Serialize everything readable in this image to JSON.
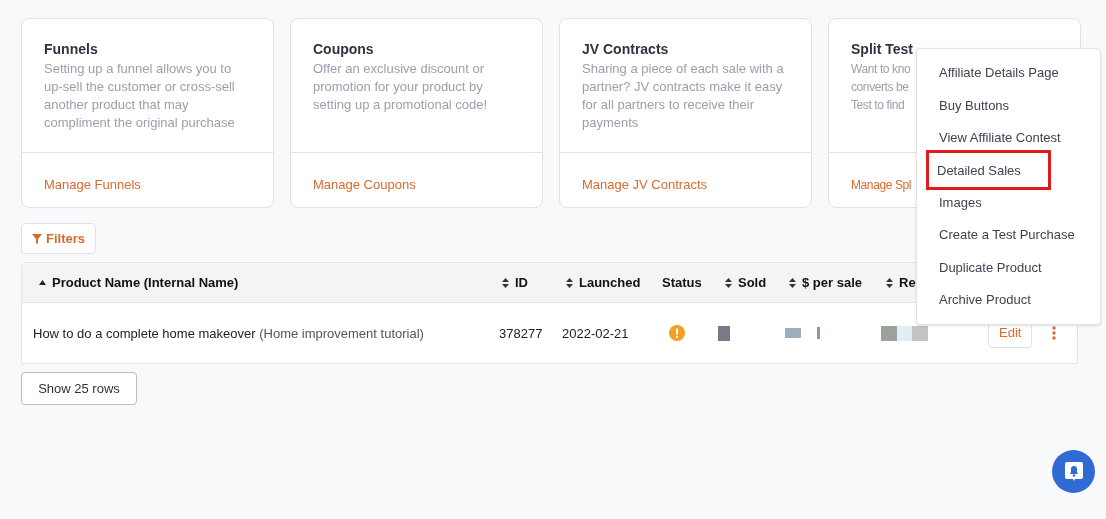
{
  "cards": [
    {
      "title": "Funnels",
      "description": "Setting up a funnel allows you to up-sell the customer or cross-sell another product that may compliment the original purchase",
      "link": "Manage Funnels"
    },
    {
      "title": "Coupons",
      "description": "Offer an exclusive discount or promotion for your product by setting up a promotional code!",
      "link": "Manage Coupons"
    },
    {
      "title": "JV Contracts",
      "description": "Sharing a piece of each sale with a partner? JV contracts make it easy for all partners to receive their payments",
      "link": "Manage JV Contracts"
    },
    {
      "title": "Split Test",
      "description_lines": [
        "Want to kno",
        "converts be",
        "Test to find"
      ],
      "link": "Manage Spl"
    }
  ],
  "filters_button": "Filters",
  "table": {
    "columns": [
      {
        "label": "Product Name (Internal Name)",
        "sortable": true,
        "sorted_ascending": true
      },
      {
        "label": "ID",
        "sortable": true,
        "sorted_ascending": false
      },
      {
        "label": "Launched",
        "sortable": true,
        "sorted_ascending": false
      },
      {
        "label": "Status",
        "sortable": false
      },
      {
        "label": "Sold",
        "sortable": true,
        "sorted_ascending": false
      },
      {
        "label": "$ per sale",
        "sortable": true,
        "sorted_ascending": false
      },
      {
        "label": "Re",
        "sortable": true,
        "sorted_ascending": false
      }
    ],
    "rows": [
      {
        "name": "How to do a complete home makeover",
        "internal_name": "(Home improvement tutorial)",
        "id": "378277",
        "launched": "2022-02-21",
        "warning": true,
        "action": "Edit"
      }
    ]
  },
  "show_rows_button": "Show 25 rows",
  "menu": {
    "items": [
      {
        "label": "Affiliate Details Page",
        "highlighted": false
      },
      {
        "label": "Buy Buttons",
        "highlighted": false
      },
      {
        "label": "View Affiliate Contest",
        "highlighted": false
      },
      {
        "label": "Detailed Sales",
        "highlighted": true
      },
      {
        "label": "Images",
        "highlighted": false
      },
      {
        "label": "Create a Test Purchase",
        "highlighted": false
      },
      {
        "label": "Duplicate Product",
        "highlighted": false
      },
      {
        "label": "Archive Product",
        "highlighted": false
      }
    ]
  }
}
